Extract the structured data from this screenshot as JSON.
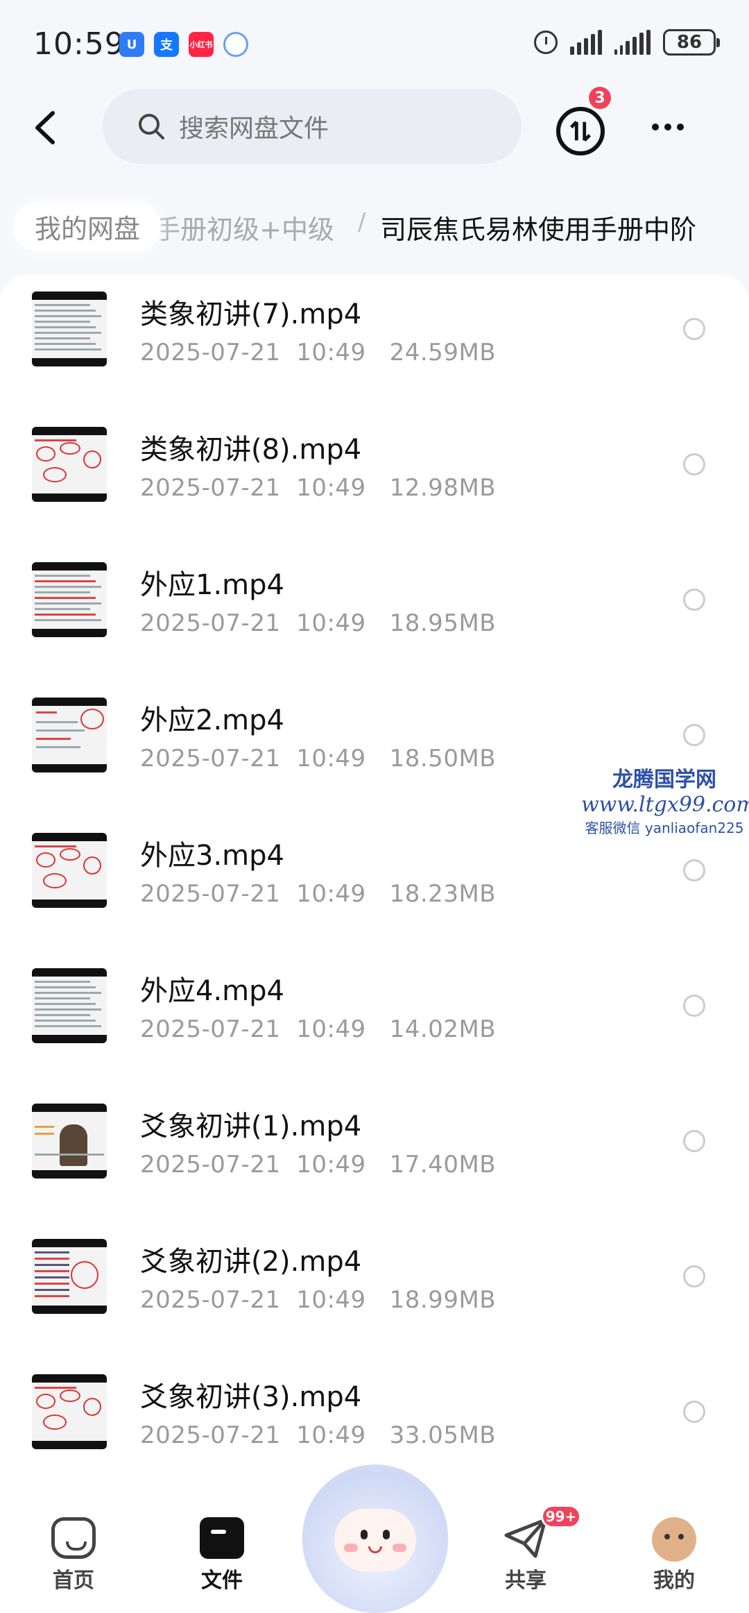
{
  "status_bar": {
    "time": "10:59",
    "battery": "86",
    "app_icons": [
      {
        "name": "shield-app-icon",
        "label": "U",
        "color": "#2e7cf6"
      },
      {
        "name": "alipay-app-icon",
        "label": "支",
        "color": "#1677ff"
      },
      {
        "name": "xiaohongshu-app-icon",
        "label": "小红书",
        "color": "#ff2442"
      },
      {
        "name": "netdisk-app-icon",
        "label": "",
        "color": "#ffffff"
      }
    ]
  },
  "header": {
    "search_placeholder": "搜索网盘文件",
    "transfer_badge": "3"
  },
  "breadcrumb": {
    "root": "我的网盘",
    "middle": "手册初级+中级",
    "separator": "/",
    "current": "司辰焦氏易林使用手册中阶"
  },
  "files": [
    {
      "name": "类象初讲(7).mp4",
      "meta": "2025-07-21  10:49   24.59MB",
      "thumb": "text"
    },
    {
      "name": "类象初讲(8).mp4",
      "meta": "2025-07-21  10:49   12.98MB",
      "thumb": "red-sketch"
    },
    {
      "name": "外应1.mp4",
      "meta": "2025-07-21  10:49   18.95MB",
      "thumb": "text-red"
    },
    {
      "name": "外应2.mp4",
      "meta": "2025-07-21  10:49   18.50MB",
      "thumb": "slide"
    },
    {
      "name": "外应3.mp4",
      "meta": "2025-07-21  10:49   18.23MB",
      "thumb": "red-sketch"
    },
    {
      "name": "外应4.mp4",
      "meta": "2025-07-21  10:49   14.02MB",
      "thumb": "text"
    },
    {
      "name": "爻象初讲(1).mp4",
      "meta": "2025-07-21  10:49   17.40MB",
      "thumb": "person"
    },
    {
      "name": "爻象初讲(2).mp4",
      "meta": "2025-07-21  10:49   18.99MB",
      "thumb": "table"
    },
    {
      "name": "爻象初讲(3).mp4",
      "meta": "2025-07-21  10:49   33.05MB",
      "thumb": "red-sketch"
    }
  ],
  "watermark": {
    "title": "龙腾国学网",
    "url": "www.ltgx99.com",
    "contact": "客服微信 yanliaofan225"
  },
  "bottom_nav": {
    "home": "首页",
    "files": "文件",
    "share": "共享",
    "share_badge": "99+",
    "mine": "我的"
  }
}
